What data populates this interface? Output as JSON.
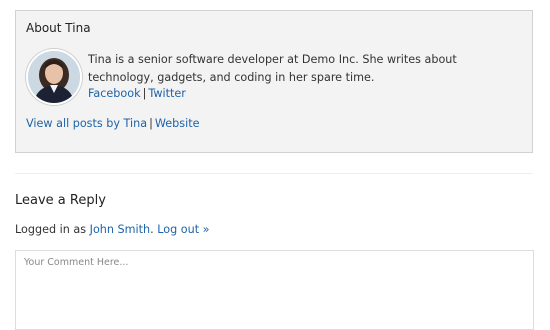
{
  "author_box": {
    "title": "About Tina",
    "bio": "Tina is a senior software developer at Demo Inc. She writes about technology, gadgets, and coding in her spare time.",
    "links": {
      "facebook": "Facebook",
      "separator": "|",
      "twitter": "Twitter"
    },
    "view_all": "View all posts by Tina",
    "view_separator": "|",
    "website": "Website"
  },
  "reply": {
    "title": "Leave a Reply",
    "logged_in_prefix": "Logged in as",
    "user_name": "John Smith",
    "period": ".",
    "logout": "Log out »",
    "comment_placeholder": "Your Comment Here..."
  },
  "colors": {
    "link": "#1e63a8",
    "box_background": "#f3f3f3",
    "box_border": "#d2d2d2"
  }
}
